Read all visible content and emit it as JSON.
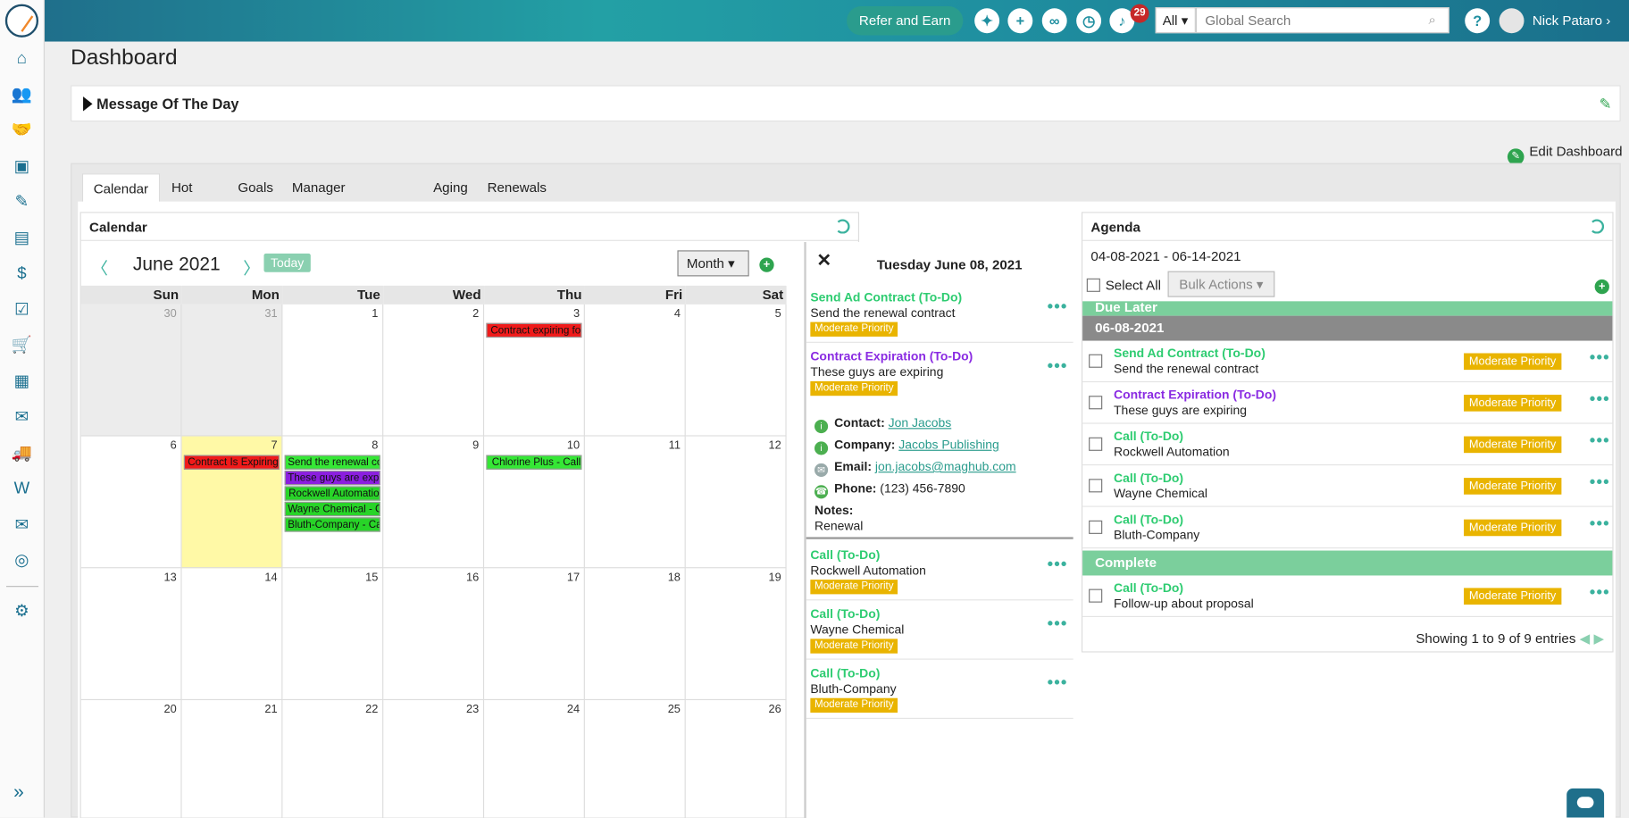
{
  "topbar": {
    "refer_label": "Refer and Earn",
    "notification_count": "29",
    "search_scope": "All",
    "search_placeholder": "Global Search",
    "user_name": "Nick Pataro"
  },
  "page": {
    "title": "Dashboard",
    "motd_title": "Message Of The Day",
    "edit_dashboard": "Edit Dashboard"
  },
  "tabs": [
    {
      "label": "Calendar"
    },
    {
      "label": "Hot List"
    },
    {
      "label": "Goals"
    },
    {
      "label": "Manager Dashboard"
    },
    {
      "label": "Aging"
    },
    {
      "label": "Renewals"
    }
  ],
  "calendar": {
    "title": "Calendar",
    "month_label": "June 2021",
    "today_label": "Today",
    "view": "Month",
    "prev_arrow": "〈",
    "next_arrow": "〉",
    "days_of_week": [
      "Sun",
      "Mon",
      "Tue",
      "Wed",
      "Thu",
      "Fri",
      "Sat"
    ],
    "weeks": [
      [
        "30",
        "31",
        "1",
        "2",
        "3",
        "4",
        "5"
      ],
      [
        "6",
        "7",
        "8",
        "9",
        "10",
        "11",
        "12"
      ],
      [
        "13",
        "14",
        "15",
        "16",
        "17",
        "18",
        "19"
      ],
      [
        "20",
        "21",
        "22",
        "23",
        "24",
        "25",
        "26"
      ]
    ],
    "events": [
      {
        "text": "Contract expiring fo",
        "color": "red"
      },
      {
        "text": "Contract Is Expiring",
        "color": "red"
      },
      {
        "text": "Send the renewal co",
        "color": "green"
      },
      {
        "text": "These guys are expi",
        "color": "purple"
      },
      {
        "text": "Rockwell Automatio",
        "color": "green2"
      },
      {
        "text": "Wayne Chemical - C",
        "color": "green2"
      },
      {
        "text": "Bluth-Company - Ca",
        "color": "green2"
      },
      {
        "text": "Chlorine Plus - Call",
        "color": "green"
      }
    ]
  },
  "day_panel": {
    "close": "✕",
    "title": "Tuesday June 08, 2021",
    "items": [
      {
        "title": "Send Ad Contract (To-Do)",
        "subtitle": "Send the renewal contract",
        "badge": "Moderate Priority",
        "color": "green"
      },
      {
        "title": "Contract Expiration (To-Do)",
        "subtitle": "These guys are expiring",
        "badge": "Moderate Priority",
        "color": "purple"
      },
      {
        "title": "Call (To-Do)",
        "subtitle": "Rockwell Automation",
        "badge": "Moderate Priority",
        "color": "green"
      },
      {
        "title": "Call (To-Do)",
        "subtitle": "Wayne Chemical",
        "badge": "Moderate Priority",
        "color": "green"
      },
      {
        "title": "Call (To-Do)",
        "subtitle": "Bluth-Company",
        "badge": "Moderate Priority",
        "color": "green"
      }
    ],
    "contact": {
      "contact_label": "Contact:",
      "contact_value": "Jon Jacobs",
      "company_label": "Company:",
      "company_value": "Jacobs Publishing",
      "email_label": "Email:",
      "email_value": "jon.jacobs@maghub.com",
      "phone_label": "Phone:",
      "phone_value": "(123) 456-7890",
      "notes_label": "Notes:",
      "notes_value": "Renewal"
    }
  },
  "agenda": {
    "title": "Agenda",
    "range": "04-08-2021 - 06-14-2021",
    "select_all": "Select All",
    "bulk_actions": "Bulk Actions",
    "due_later": "Due Later",
    "date_group": "06-08-2021",
    "complete": "Complete",
    "rows": [
      {
        "title": "Send Ad Contract (To-Do)",
        "subtitle": "Send the renewal contract",
        "badge": "Moderate Priority",
        "color": "green"
      },
      {
        "title": "Contract Expiration (To-Do)",
        "subtitle": "These guys are expiring",
        "badge": "Moderate Priority",
        "color": "purple"
      },
      {
        "title": "Call (To-Do)",
        "subtitle": "Rockwell Automation",
        "badge": "Moderate Priority",
        "color": "green"
      },
      {
        "title": "Call (To-Do)",
        "subtitle": "Wayne Chemical",
        "badge": "Moderate Priority",
        "color": "green"
      },
      {
        "title": "Call (To-Do)",
        "subtitle": "Bluth-Company",
        "badge": "Moderate Priority",
        "color": "green"
      }
    ],
    "complete_rows": [
      {
        "title": "Call (To-Do)",
        "subtitle": "Follow-up about proposal",
        "badge": "Moderate Priority",
        "color": "green"
      }
    ],
    "footer": "Showing 1 to 9 of 9 entries"
  },
  "sidebar": {
    "icons": [
      "home-icon",
      "contacts-icon",
      "handshake-icon",
      "image-icon",
      "ticket-icon",
      "document-icon",
      "finance-icon",
      "clipboard-icon",
      "cart-icon",
      "calendar-icon",
      "mailbox-icon",
      "truck-icon",
      "w2-icon",
      "mail-icon",
      "support-icon",
      "gear-icon"
    ]
  }
}
